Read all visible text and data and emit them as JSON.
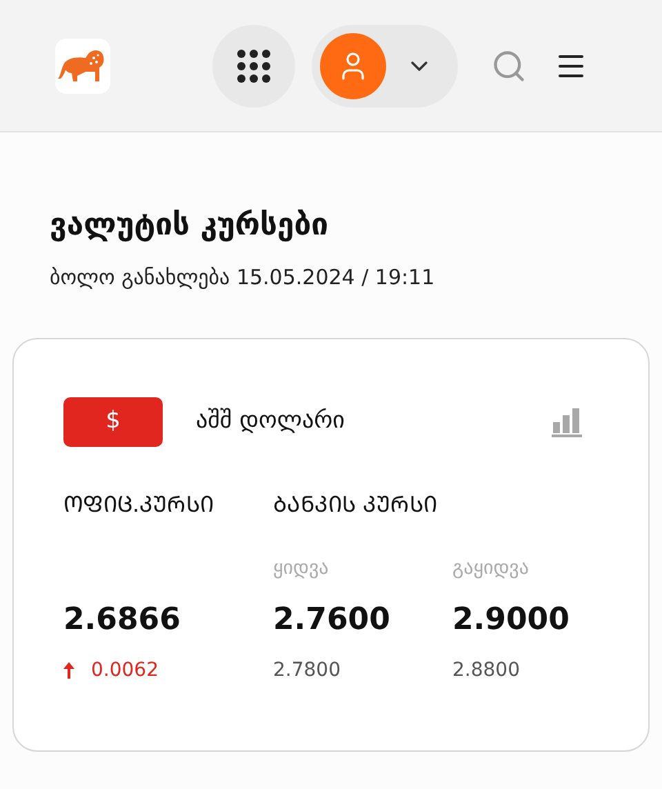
{
  "page": {
    "title": "ვალუტის კურსები",
    "updated": "ბოლო განახლება 15.05.2024 / 19:11"
  },
  "currency": {
    "symbol": "$",
    "name": "აშშ დოლარი",
    "color": "#e0261f"
  },
  "headings": {
    "official": "ᲝᲤᲘᲪ.ᲙᲣᲠᲡᲘ",
    "bank": "ᲑᲐᲜᲙᲘᲡ ᲙᲣᲠᲡᲘ"
  },
  "official": {
    "value": "2.6866",
    "change": "0.0062",
    "rising": true
  },
  "bank": [
    {
      "label": "ყიდვა",
      "value": "2.7600",
      "previous": "2.7800"
    },
    {
      "label": "გაყიდვა",
      "value": "2.9000",
      "previous": "2.8800"
    }
  ]
}
